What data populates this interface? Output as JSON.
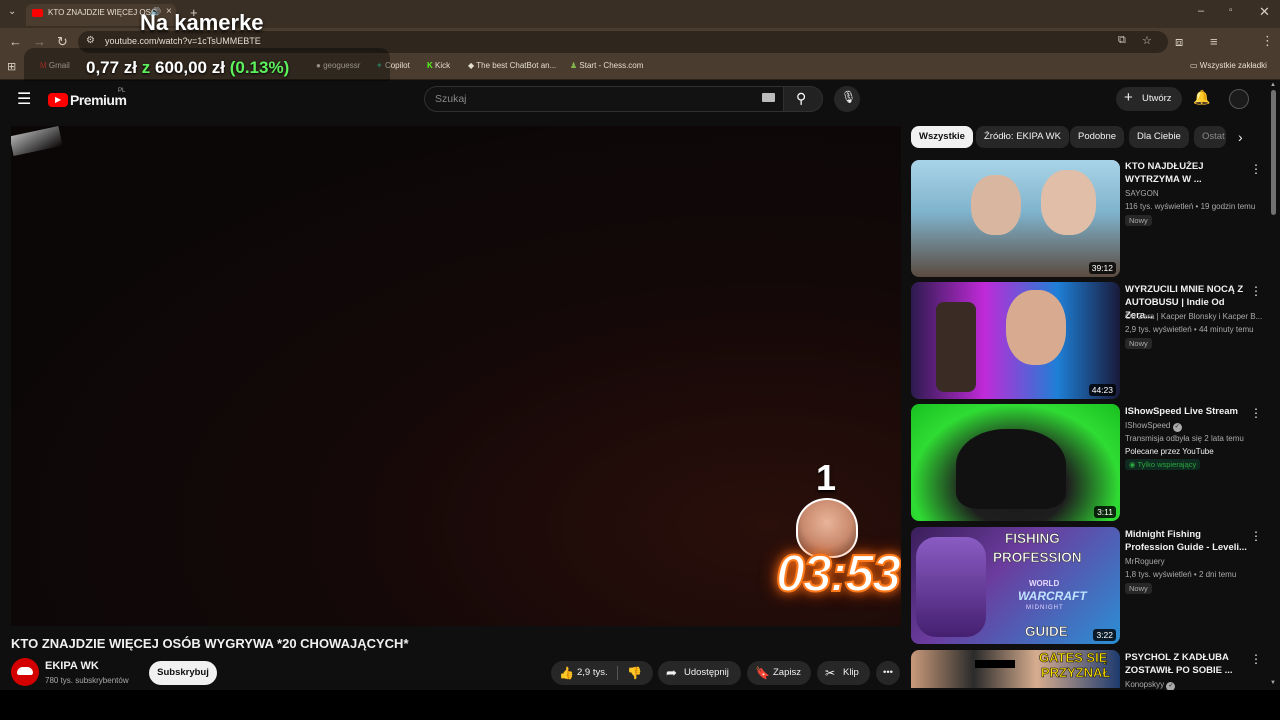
{
  "browser": {
    "tab_title": "KTO ZNAJDZIE WIĘCEJ OSÓ",
    "url": "youtube.com/watch?v=1cTsUMMEBTE",
    "bookmarks": [
      "Gmail",
      "geoguessr",
      "Copilot",
      "Kick",
      "The best ChatBot an...",
      "Start - Chess.com"
    ],
    "all_bookmarks": "Wszystkie zakładki"
  },
  "overlay": {
    "title": "Na kamerke",
    "amount": "0,77 zł",
    "of": "z",
    "goal": "600,00 zł",
    "percent": "(0.13%)"
  },
  "youtube": {
    "logo": "Premium",
    "logo_sup": "PL",
    "search_placeholder": "Szukaj",
    "create_label": "Utwórz"
  },
  "video": {
    "title": "KTO ZNAJDZIE WIĘCEJ OSÓB WYGRYWA *20 CHOWAJĄCYCH*",
    "channel": "EKIPA WK",
    "subscribers": "780 tys. subskrybentów",
    "subscribe_label": "Subskrybuj",
    "likes": "2,9 tys.",
    "share_label": "Udostępnij",
    "save_label": "Zapisz",
    "clip_label": "Klip",
    "overlay_number": "1",
    "overlay_timer": "03:53"
  },
  "chips": [
    "Wszystkie",
    "Źródło: EKIPA WK",
    "Podobne",
    "Dla Ciebie",
    "Ostat"
  ],
  "sidebar": [
    {
      "title": "KTO NAJDŁUŻEJ WYTRZYMA W ...",
      "channel": "SAYGON",
      "meta": "116 tys. wyświetleń • 19 godzin temu",
      "badge": "Nowy",
      "duration": "39:12"
    },
    {
      "title": "WYRZUCILI MNIE NOCĄ Z AUTOBUSU | Indie Od Zera...",
      "channel": "Od Zera | Kacper Blonsky i Kacper B...",
      "meta": "2,9 tys. wyświetleń • 44 minuty temu",
      "badge": "Nowy",
      "duration": "44:23"
    },
    {
      "title": "IShowSpeed Live Stream",
      "channel": "IShowSpeed",
      "meta": "Transmisja odbyła się 2 lata temu",
      "extra": "Polecane przez YouTube",
      "badge": "Tylko wspierający",
      "duration": "3:11"
    },
    {
      "title": "Midnight Fishing Profession Guide - Leveli...",
      "channel": "MrRoguery",
      "meta": "1,8 tys. wyświetleń • 2 dni temu",
      "badge": "Nowy",
      "duration": "3:22",
      "thumb_text": [
        "FISHING",
        "PROFESSION",
        "WORLD",
        "WARCRAFT",
        "MIDNIGHT",
        "GUIDE"
      ]
    },
    {
      "title": "PSYCHOL Z KADŁUBA ZOSTAWIŁ PO SOBIE ...",
      "channel": "Konopskyy",
      "thumb_text": [
        "GATES SIĘ",
        "PRZYZNAŁ"
      ]
    }
  ]
}
